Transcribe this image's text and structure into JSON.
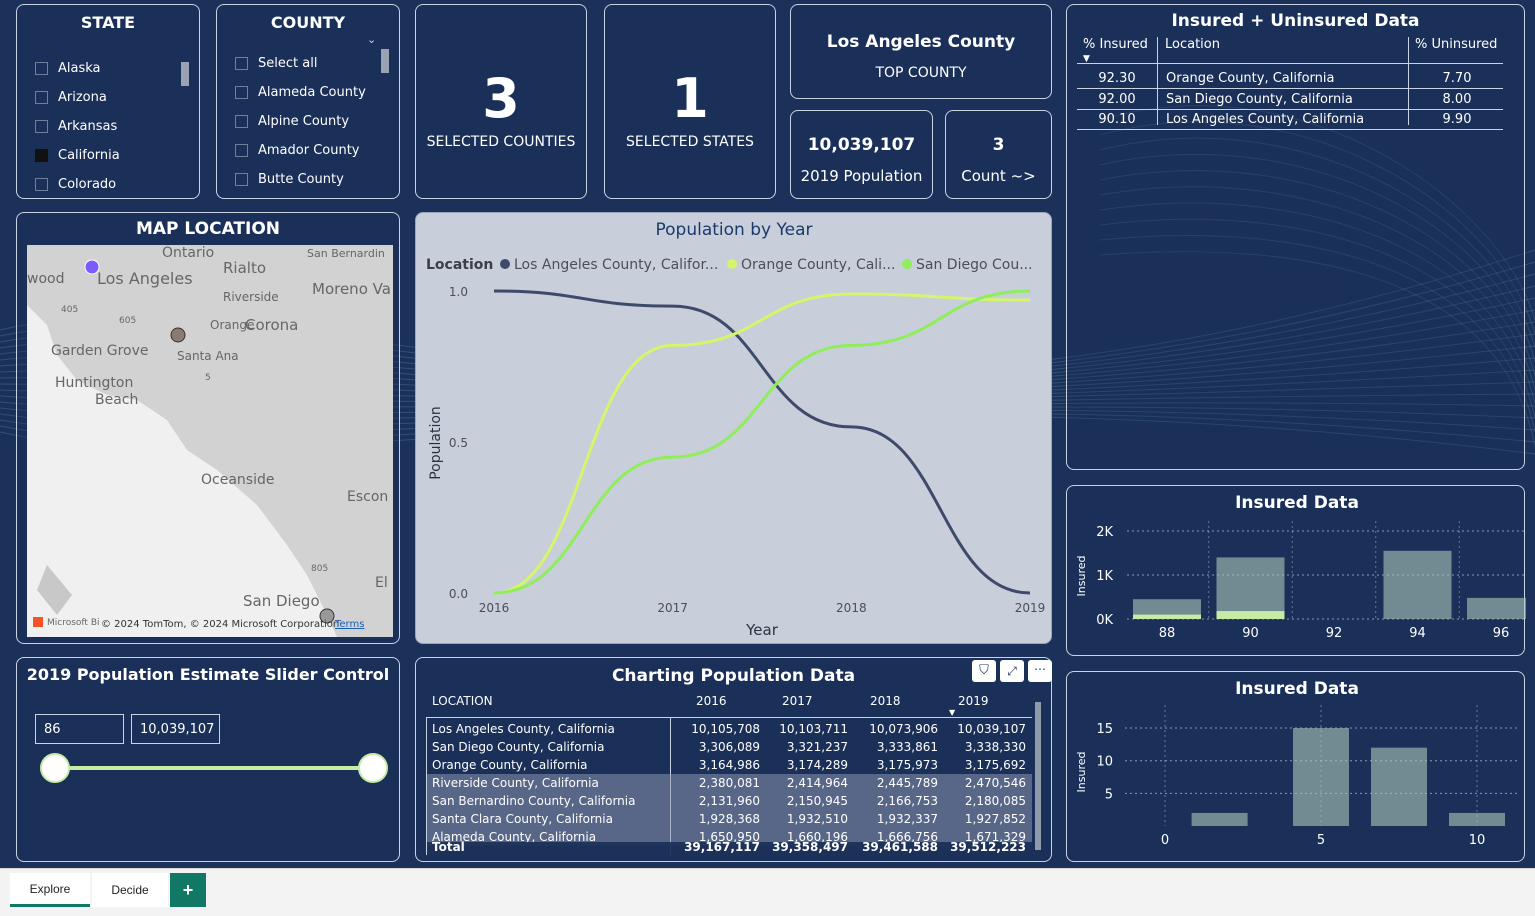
{
  "state_slicer": {
    "title": "STATE",
    "items": [
      {
        "label": "Alaska",
        "checked": false
      },
      {
        "label": "Arizona",
        "checked": false
      },
      {
        "label": "Arkansas",
        "checked": false
      },
      {
        "label": "California",
        "checked": true
      },
      {
        "label": "Colorado",
        "checked": false
      }
    ]
  },
  "county_slicer": {
    "title": "COUNTY",
    "items": [
      {
        "label": "Select all"
      },
      {
        "label": "Alameda County"
      },
      {
        "label": "Alpine County"
      },
      {
        "label": "Amador County"
      },
      {
        "label": "Butte County"
      }
    ]
  },
  "kpis": {
    "selected_counties": {
      "value": "3",
      "label": "SELECTED COUNTIES"
    },
    "selected_states": {
      "value": "1",
      "label": "SELECTED STATES"
    },
    "top_county": {
      "value": "Los Angeles County",
      "label": "TOP COUNTY"
    },
    "population": {
      "value": "10,039,107",
      "label": "2019 Population"
    },
    "count": {
      "value": "3",
      "label": "Count ~>"
    }
  },
  "insured_table": {
    "title": "Insured + Uninsured Data",
    "headers": [
      "% Insured",
      "Location",
      "% Uninsured"
    ],
    "rows": [
      [
        "92.30",
        "Orange County, California",
        "7.70"
      ],
      [
        "92.00",
        "San Diego County, California",
        "8.00"
      ],
      [
        "90.10",
        "Los Angeles County, California",
        "9.90"
      ]
    ]
  },
  "map": {
    "title": "MAP LOCATION",
    "labels": [
      "Ontario",
      "San Bernardin",
      "Rialto",
      "wood",
      "Los Angeles",
      "Riverside",
      "Moreno Va",
      "405",
      "605",
      "Orange",
      "Corona",
      "Garden Grove",
      "Santa Ana",
      "5",
      "Huntington",
      "Beach",
      "Oceanside",
      "Escon",
      "805",
      "El",
      "San Diego"
    ],
    "attribution": "© 2024 TomTom, © 2024 Microsoft Corporation",
    "brand": "Microsoft Bi",
    "terms": "Terms"
  },
  "slider": {
    "title": "2019 Population Estimate Slider Control",
    "min": "86",
    "max": "10,039,107",
    "level_low": 0.0,
    "level_high": 1.0
  },
  "pop_chart": {
    "title": "Population by Year",
    "legend_title": "Location",
    "ylabel": "Population",
    "xlabel": "Year"
  },
  "chart_data": [
    {
      "type": "line",
      "title": "Population by Year",
      "xlabel": "Year",
      "ylabel": "Population",
      "x": [
        2016,
        2017,
        2018,
        2019
      ],
      "ylim": [
        0,
        1
      ],
      "yticks": [
        "0.0",
        "0.5",
        "1.0"
      ],
      "legend_position": "top",
      "series": [
        {
          "name": "Los Angeles County, Califor...",
          "color": "#3d4a6a",
          "values": [
            1.0,
            0.95,
            0.55,
            0.0
          ]
        },
        {
          "name": "Orange County, Cali...",
          "color": "#d5f56a",
          "values": [
            0.0,
            0.82,
            0.99,
            0.97
          ]
        },
        {
          "name": "San Diego Cou...",
          "color": "#8fee5a",
          "values": [
            0.0,
            0.45,
            0.82,
            1.0
          ]
        }
      ]
    },
    {
      "type": "bar",
      "title": "Insured Data",
      "ylabel": "Insured",
      "x": [
        88,
        90,
        92,
        94,
        96
      ],
      "ylim": [
        0,
        2000
      ],
      "yticks": [
        "0K",
        "1K",
        "2K"
      ],
      "bars": [
        {
          "x": 88,
          "value": 450
        },
        {
          "x": 88,
          "value": 100,
          "color": "#c7eba5"
        },
        {
          "x": 90,
          "value": 1400
        },
        {
          "x": 90,
          "value": 180,
          "color": "#c7eba5"
        },
        {
          "x": 94,
          "value": 1550
        },
        {
          "x": 96,
          "value": 480
        }
      ]
    },
    {
      "type": "bar",
      "title": "Insured Data",
      "ylabel": "Insured",
      "x": [
        0,
        5,
        10
      ],
      "ylim": [
        0,
        17
      ],
      "yticks": [
        "5",
        "10",
        "15"
      ],
      "bars": [
        {
          "x": 1.75,
          "value": 2
        },
        {
          "x": 5,
          "value": 15
        },
        {
          "x": 7.5,
          "value": 12
        },
        {
          "x": 10,
          "value": 2
        }
      ]
    }
  ],
  "pop_table": {
    "title": "Charting Population Data",
    "headers": [
      "LOCATION",
      "2016",
      "2017",
      "2018",
      "2019"
    ],
    "rows": [
      [
        "Los Angeles County, California",
        "10,105,708",
        "10,103,711",
        "10,073,906",
        "10,039,107"
      ],
      [
        "San Diego County, California",
        "3,306,089",
        "3,321,237",
        "3,333,861",
        "3,338,330"
      ],
      [
        "Orange County, California",
        "3,164,986",
        "3,174,289",
        "3,175,973",
        "3,175,692"
      ],
      [
        "Riverside County, California",
        "2,380,081",
        "2,414,964",
        "2,445,789",
        "2,470,546"
      ],
      [
        "San Bernardino County, California",
        "2,131,960",
        "2,150,945",
        "2,166,753",
        "2,180,085"
      ],
      [
        "Santa Clara County, California",
        "1,928,368",
        "1,932,510",
        "1,932,337",
        "1,927,852"
      ],
      [
        "Alameda County, California",
        "1,650,950",
        "1,660,196",
        "1,666,756",
        "1,671,329"
      ]
    ],
    "total": [
      "Total",
      "39,167,117",
      "39,358,497",
      "39,461,588",
      "39,512,223"
    ]
  },
  "tabs": [
    "Explore",
    "Decide",
    "+"
  ]
}
